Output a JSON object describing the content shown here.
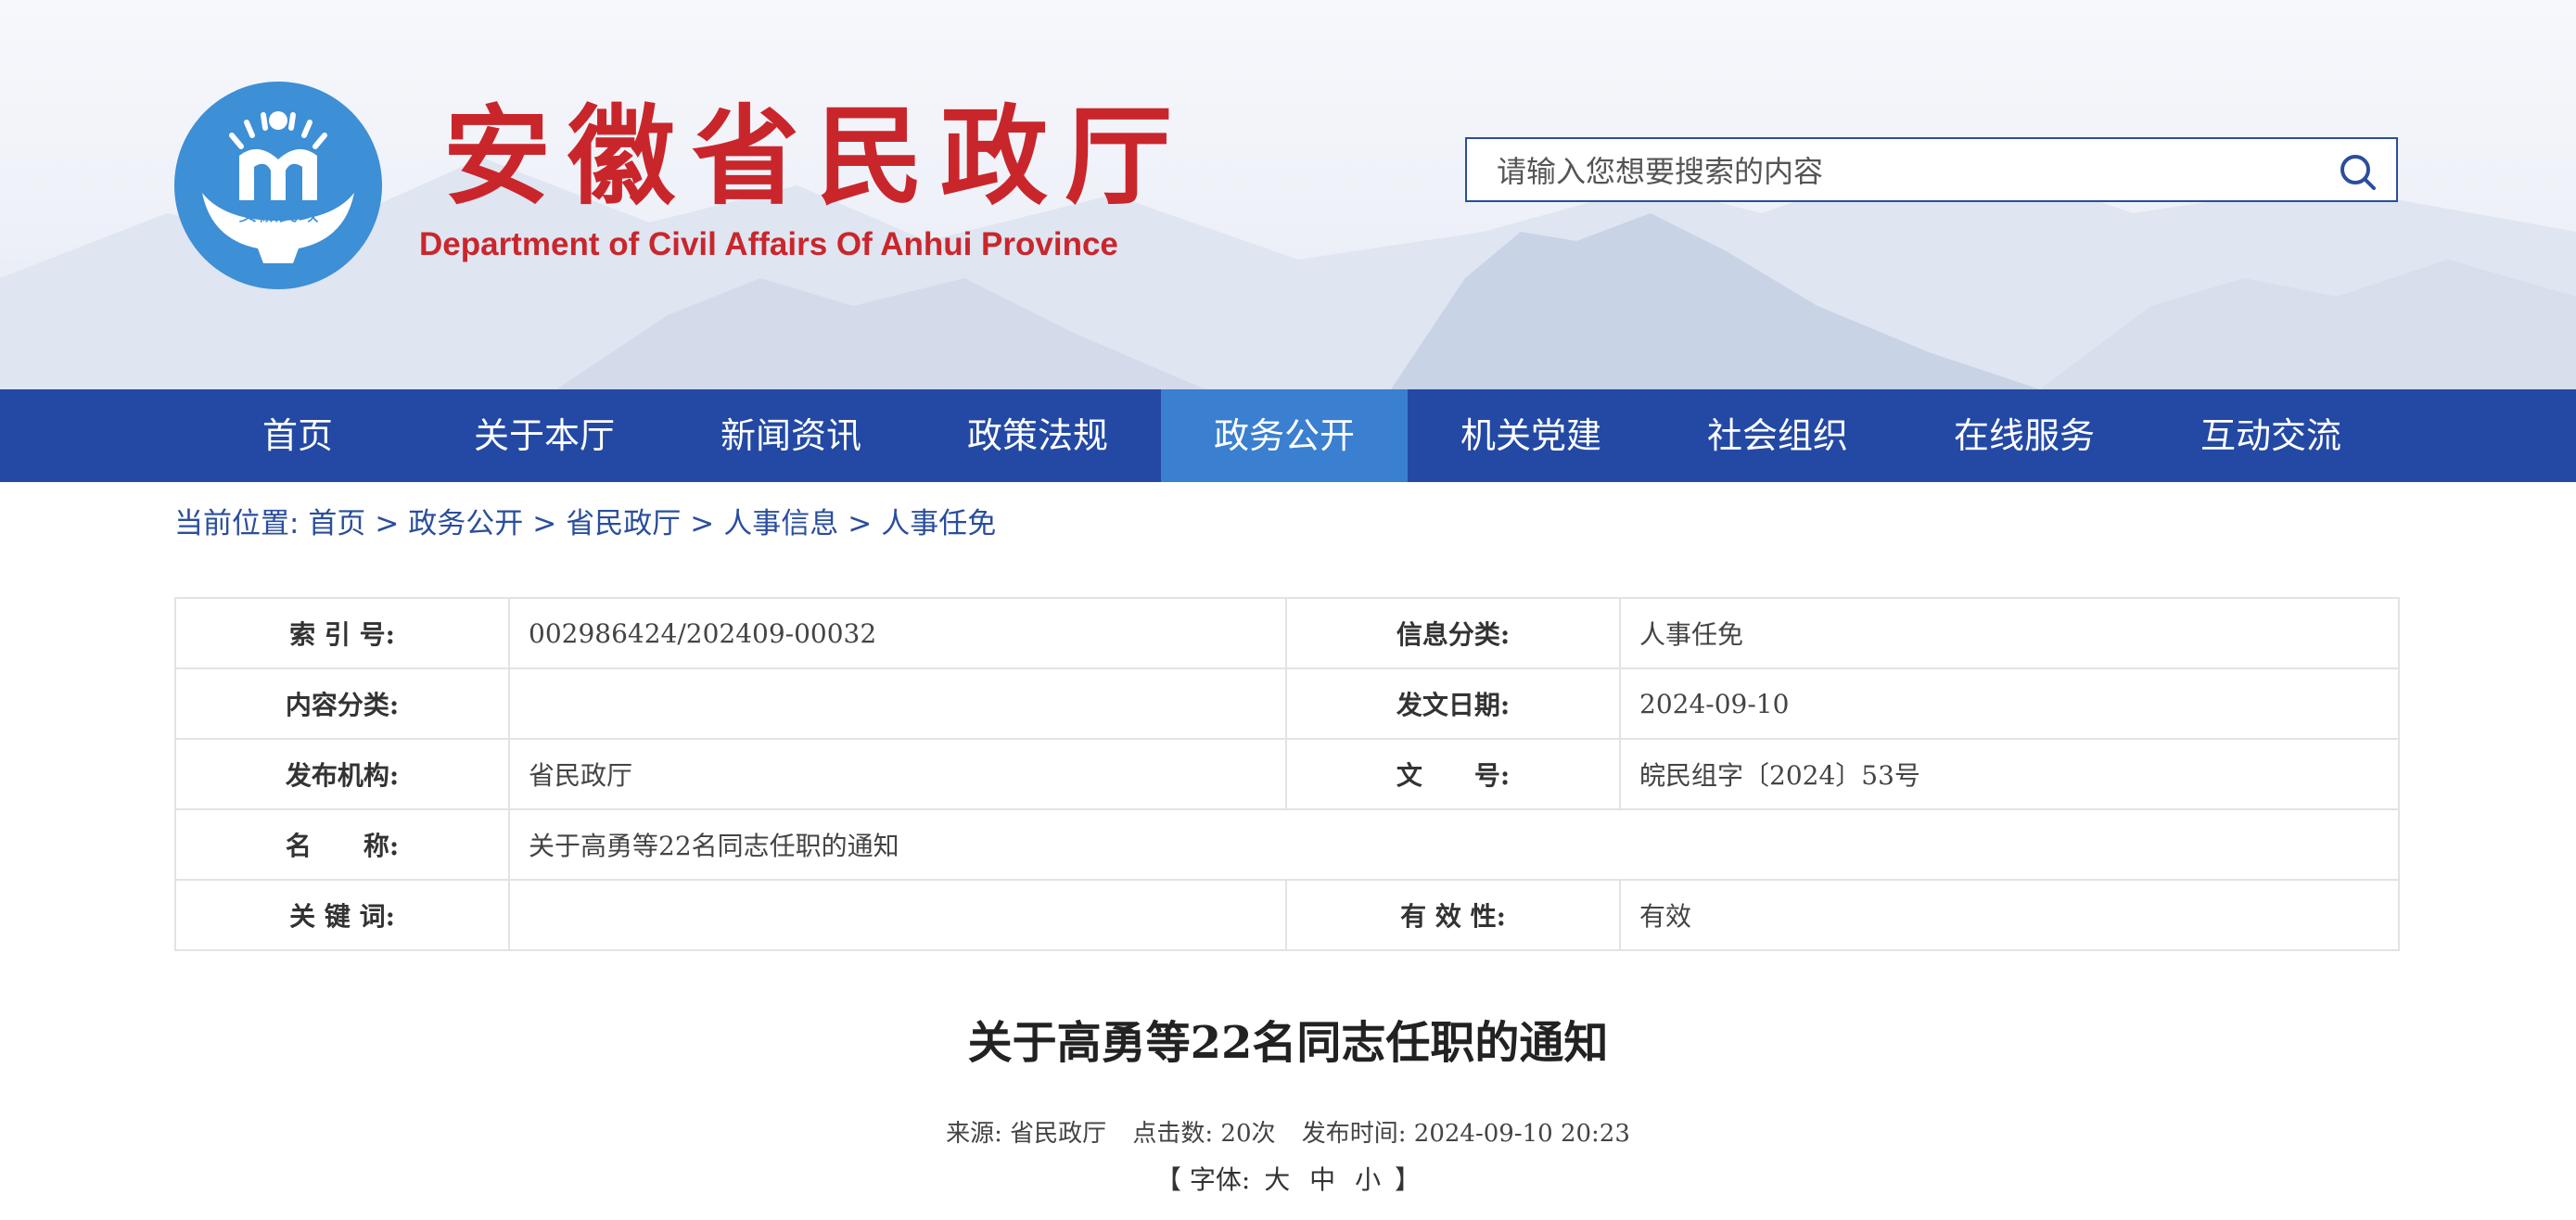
{
  "site": {
    "title": "安徽省民政厅",
    "subtitle": "Department of Civil Affairs Of Anhui Province",
    "logo_text": "安徽民政",
    "brand_red": "#c9262c",
    "brand_blue": "#2349a4"
  },
  "search": {
    "placeholder": "请输入您想要搜索的内容",
    "icon": "search-icon"
  },
  "nav": {
    "items": [
      "首页",
      "关于本厅",
      "新闻资讯",
      "政策法规",
      "政务公开",
      "机关党建",
      "社会组织",
      "在线服务",
      "互动交流"
    ],
    "active": "政务公开"
  },
  "breadcrumb": {
    "label": "当前位置:",
    "items": [
      "首页",
      "政务公开",
      "省民政厅",
      "人事信息",
      "人事任免"
    ],
    "separator": ">"
  },
  "meta": {
    "index_label": "索 引 号:",
    "index_value": "002986424/202409-00032",
    "category_label": "信息分类:",
    "category_value": "人事任免",
    "content_label": "内容分类:",
    "content_value": "",
    "date_label": "发文日期:",
    "date_value": "2024-09-10",
    "issuer_label": "发布机构:",
    "issuer_value": "省民政厅",
    "docno_label": "文　　号:",
    "docno_value": "皖民组字〔2024〕53号",
    "name_label": "名　　称:",
    "name_value": "关于高勇等22名同志任职的通知",
    "keywords_label": "关 键 词:",
    "keywords_value": "",
    "validity_label": "有 效 性:",
    "validity_value": "有效"
  },
  "article": {
    "title": "关于高勇等22名同志任职的通知",
    "source": "来源: 省民政厅",
    "clicks": "点击数: 20次",
    "published": "发布时间: 2024-09-10 20:23",
    "font_open": "【 字体:",
    "font_large": "大",
    "font_medium": "中",
    "font_small": "小",
    "font_close": "】"
  }
}
